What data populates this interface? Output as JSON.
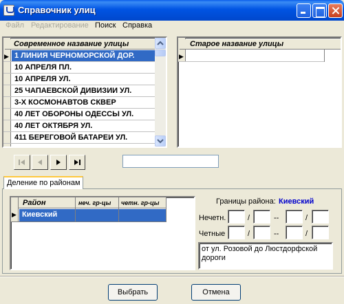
{
  "window": {
    "title": "Справочник улиц"
  },
  "menu": {
    "items": [
      "Файл",
      "Редактирование",
      "Поиск",
      "Справка"
    ]
  },
  "modern_grid": {
    "header": "Современное название улицы",
    "rows": [
      "1 ЛИНИЯ ЧЕРНОМОРСКОЙ ДОР.",
      "10 АПРЕЛЯ ПЛ.",
      "10 АПРЕЛЯ УЛ.",
      "25 ЧАПАЕВСКОЙ ДИВИЗИИ УЛ.",
      "3-Х КОСМОНАВТОВ СКВЕР",
      "40 ЛЕТ ОБОРОНЫ ОДЕССЫ УЛ.",
      "40 ЛЕТ ОКТЯБРЯ УЛ.",
      "411 БЕРЕГОВОЙ БАТАРЕИ УЛ."
    ]
  },
  "old_grid": {
    "header": "Старое название улицы"
  },
  "tab": {
    "label": "Деление по районам"
  },
  "district_grid": {
    "columns": [
      "Район",
      "неч. гр-цы",
      "четн. гр-цы"
    ],
    "rows": [
      [
        "Киевский",
        "",
        ""
      ]
    ]
  },
  "bounds": {
    "label": "Границы района:",
    "district": "Киевский",
    "odd_label": "Нечетн.",
    "even_label": "Четные",
    "slash": "/",
    "dash": "--",
    "description": "от ул. Розовой до Люстдорфской дороги"
  },
  "buttons": {
    "select": "Выбрать",
    "cancel": "Отмена"
  }
}
